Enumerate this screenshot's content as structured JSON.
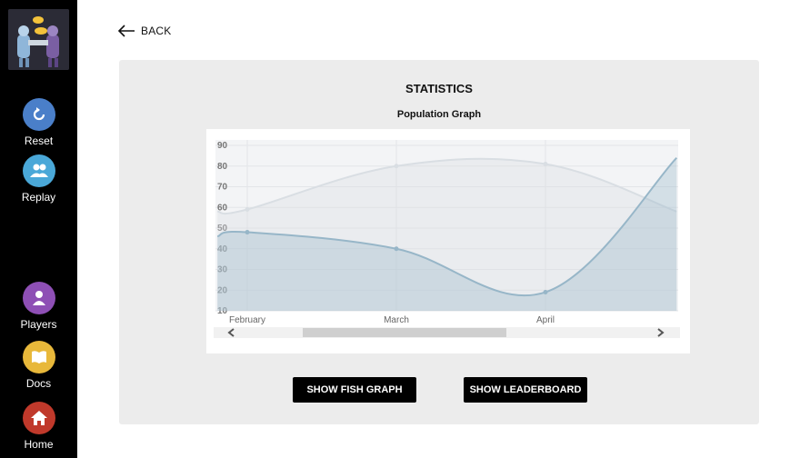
{
  "sidebar": {
    "items": [
      {
        "name": "reset",
        "label": "Reset",
        "color": "#4a7fc9",
        "icon": "refresh-icon"
      },
      {
        "name": "replay",
        "label": "Replay",
        "color": "#4aa8d8",
        "icon": "users-icon"
      },
      {
        "name": "players",
        "label": "Players",
        "color": "#8e4fb5",
        "icon": "user-icon"
      },
      {
        "name": "docs",
        "label": "Docs",
        "color": "#e8b83a",
        "icon": "book-icon"
      },
      {
        "name": "home",
        "label": "Home",
        "color": "#c0392b",
        "icon": "home-icon"
      }
    ]
  },
  "back": {
    "label": "BACK"
  },
  "panel": {
    "title": "STATISTICS",
    "graph_title": "Population Graph"
  },
  "buttons": {
    "fish": "SHOW FISH GRAPH",
    "leaderboard": "SHOW LEADERBOARD"
  },
  "chart_data": {
    "type": "area",
    "title": "Population Graph",
    "categories": [
      "February",
      "March",
      "April"
    ],
    "ylim": [
      10,
      90
    ],
    "yticks": [
      10,
      20,
      30,
      40,
      50,
      60,
      70,
      80,
      90
    ],
    "grid": true,
    "legend": "none",
    "series": [
      {
        "color": "#d9dee3",
        "values": [
          59,
          80,
          81
        ],
        "points": [
          [
            -0.2,
            58
          ],
          [
            0,
            59
          ],
          [
            1,
            80
          ],
          [
            2,
            81
          ],
          [
            2.88,
            58
          ]
        ]
      },
      {
        "color": "#97b6c8",
        "values": [
          48,
          40,
          19
        ],
        "points": [
          [
            -0.2,
            46
          ],
          [
            0,
            48
          ],
          [
            1,
            40
          ],
          [
            2,
            19
          ],
          [
            2.88,
            84
          ]
        ]
      }
    ]
  }
}
